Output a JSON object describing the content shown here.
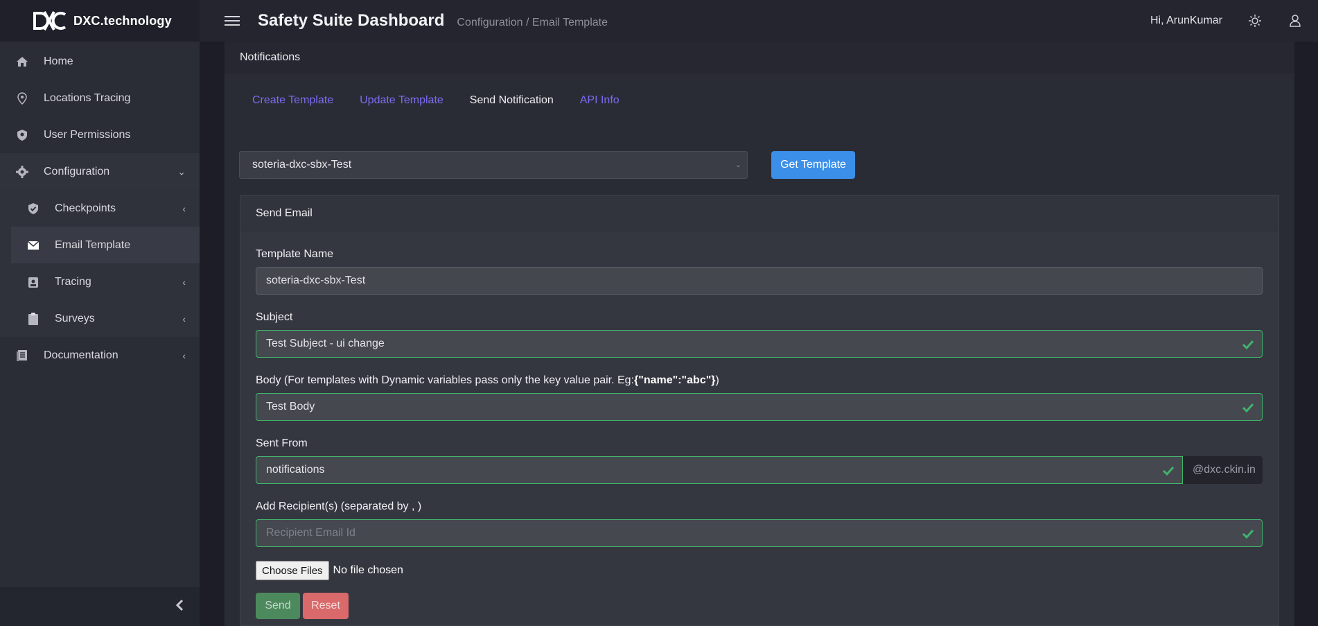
{
  "brand": {
    "name": "DXC.technology"
  },
  "sidebar": {
    "items": [
      {
        "label": "Home",
        "icon": "home-icon"
      },
      {
        "label": "Locations Tracing",
        "icon": "map-pin-icon"
      },
      {
        "label": "User Permissions",
        "icon": "shield-user-icon"
      },
      {
        "label": "Configuration",
        "icon": "gear-icon",
        "expanded": true
      },
      {
        "label": "Documentation",
        "icon": "document-icon"
      }
    ],
    "config_children": [
      {
        "label": "Checkpoints",
        "icon": "shield-check-icon"
      },
      {
        "label": "Email Template",
        "icon": "envelope-icon",
        "active": true
      },
      {
        "label": "Tracing",
        "icon": "person-trace-icon"
      },
      {
        "label": "Surveys",
        "icon": "clipboard-icon"
      }
    ]
  },
  "header": {
    "title": "Safety Suite Dashboard",
    "breadcrumb": "Configuration / Email Template",
    "greeting": "Hi, ArunKumar"
  },
  "card": {
    "title": "Notifications",
    "tabs": [
      "Create Template",
      "Update Template",
      "Send Notification",
      "API Info"
    ],
    "active_tab": "Send Notification",
    "template_select": "soteria-dxc-sbx-Test",
    "get_button": "Get Template"
  },
  "form": {
    "panel_title": "Send Email",
    "template_name_label": "Template Name",
    "template_name_value": "soteria-dxc-sbx-Test",
    "subject_label": "Subject",
    "subject_value": "Test Subject - ui change",
    "body_label_prefix": "Body (For templates with Dynamic variables pass only the key value pair. Eg:",
    "body_label_example": "{\"name\":\"abc\"}",
    "body_label_suffix": ")",
    "body_value": "Test Body",
    "sent_from_label": "Sent From",
    "sent_from_value": "notifications",
    "sent_from_domain": "@dxc.ckin.in",
    "recipients_label": "Add Recipient(s) (separated by , )",
    "recipients_placeholder": "Recipient Email Id",
    "file_button": "Choose Files",
    "file_status": "No file chosen",
    "send_button": "Send",
    "reset_button": "Reset"
  },
  "colors": {
    "accent": "#3b8fe8",
    "tab_link": "#7b6cf0",
    "valid": "#3eb56b",
    "send": "#4c8a5d",
    "reset": "#d9696a"
  }
}
